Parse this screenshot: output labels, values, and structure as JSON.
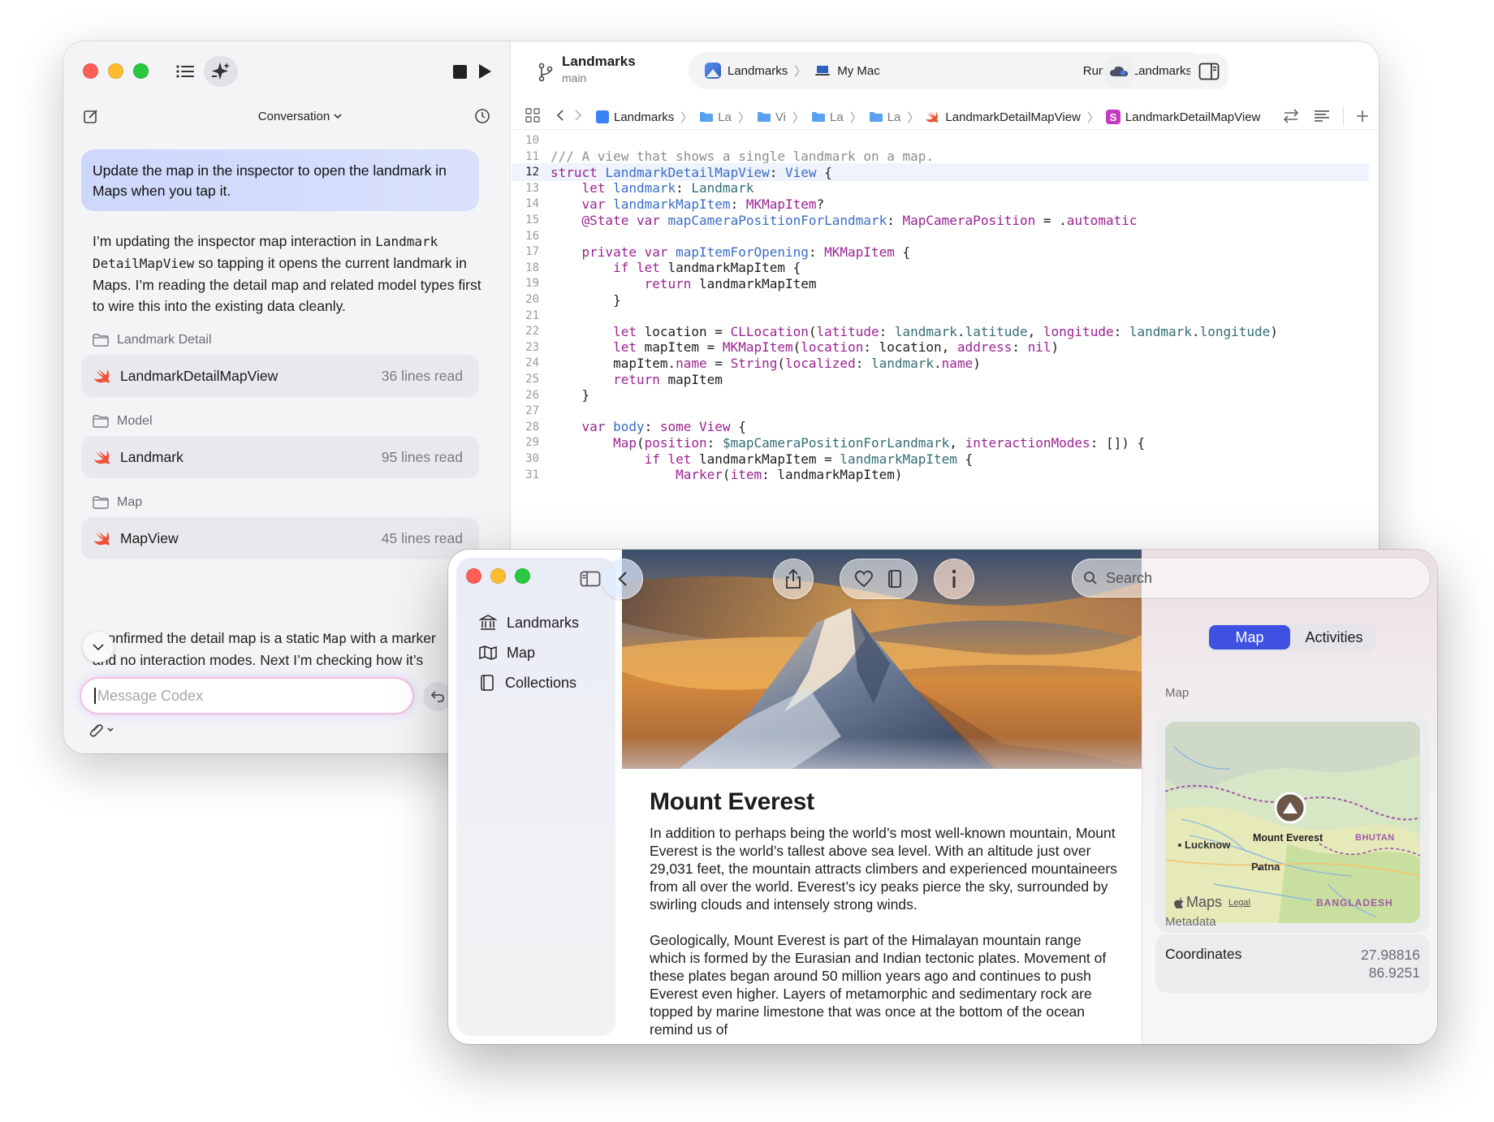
{
  "codex": {
    "conversation_title": "Conversation",
    "user_message": "Update the map in the inspector to open the landmark in Maps when you tap it.",
    "reply1": {
      "before": "I’m updating the inspector map interaction in ",
      "code1": "Landmark",
      "code2": "DetailMapView",
      "after": " so tapping it opens the current landmark in Maps. I’m reading the detail map and related model types first to wire this into the existing data cleanly."
    },
    "groups": [
      {
        "label": "Landmark Detail",
        "file": "LandmarkDetailMapView",
        "meta": "36 lines read"
      },
      {
        "label": "Model",
        "file": "Landmark",
        "meta": "95 lines read"
      },
      {
        "label": "Map",
        "file": "MapView",
        "meta": "45 lines read"
      }
    ],
    "reply2": {
      "line1_before": "I confirmed the detail map is a static ",
      "line1_code": "Map",
      "line1_after": " with a marker",
      "line2": "and no interaction modes. Next I’m checking how it’s"
    },
    "composer_placeholder": "Message Codex"
  },
  "xcode": {
    "project_name": "Landmarks",
    "branch": "main",
    "scheme": "Landmarks",
    "destination": "My Mac",
    "status": "Running Landmarks",
    "breadcrumbs": [
      "Landmarks",
      "La",
      "Vi",
      "La",
      "La",
      "LandmarkDetailMapView",
      "LandmarkDetailMapView"
    ],
    "current_line": 12,
    "code": [
      {
        "n": "10",
        "t": [
          {
            "c": "pl",
            "s": ""
          }
        ]
      },
      {
        "n": "11",
        "t": [
          {
            "c": "cm",
            "s": "/// A view that shows a single landmark on a map."
          }
        ]
      },
      {
        "n": "12",
        "t": [
          {
            "c": "kw",
            "s": "struct "
          },
          {
            "c": "ty",
            "s": "LandmarkDetailMapView"
          },
          {
            "c": "pl",
            "s": ": "
          },
          {
            "c": "ty",
            "s": "View"
          },
          {
            "c": "pl",
            "s": " {"
          }
        ]
      },
      {
        "n": "13",
        "t": [
          {
            "c": "pl",
            "s": "    "
          },
          {
            "c": "kw",
            "s": "let "
          },
          {
            "c": "ty",
            "s": "landmark"
          },
          {
            "c": "pl",
            "s": ": "
          },
          {
            "c": "id",
            "s": "Landmark"
          }
        ]
      },
      {
        "n": "14",
        "t": [
          {
            "c": "pl",
            "s": "    "
          },
          {
            "c": "kw",
            "s": "var "
          },
          {
            "c": "ty",
            "s": "landmarkMapItem"
          },
          {
            "c": "pl",
            "s": ": "
          },
          {
            "c": "kw",
            "s": "MKMapItem"
          },
          {
            "c": "pl",
            "s": "?"
          }
        ]
      },
      {
        "n": "15",
        "t": [
          {
            "c": "pl",
            "s": "    "
          },
          {
            "c": "kw",
            "s": "@State var "
          },
          {
            "c": "ty",
            "s": "mapCameraPositionForLandmark"
          },
          {
            "c": "pl",
            "s": ": "
          },
          {
            "c": "kw",
            "s": "MapCameraPosition"
          },
          {
            "c": "pl",
            "s": " = ."
          },
          {
            "c": "kw",
            "s": "automatic"
          }
        ]
      },
      {
        "n": "16",
        "t": [
          {
            "c": "pl",
            "s": ""
          }
        ]
      },
      {
        "n": "17",
        "t": [
          {
            "c": "pl",
            "s": "    "
          },
          {
            "c": "kw",
            "s": "private var "
          },
          {
            "c": "ty",
            "s": "mapItemForOpening"
          },
          {
            "c": "pl",
            "s": ": "
          },
          {
            "c": "kw",
            "s": "MKMapItem"
          },
          {
            "c": "pl",
            "s": " {"
          }
        ]
      },
      {
        "n": "18",
        "t": [
          {
            "c": "pl",
            "s": "        "
          },
          {
            "c": "kw",
            "s": "if let "
          },
          {
            "c": "pl",
            "s": "landmarkMapItem {"
          }
        ]
      },
      {
        "n": "19",
        "t": [
          {
            "c": "pl",
            "s": "            "
          },
          {
            "c": "kw",
            "s": "return "
          },
          {
            "c": "pl",
            "s": "landmarkMapItem"
          }
        ]
      },
      {
        "n": "20",
        "t": [
          {
            "c": "pl",
            "s": "        }"
          }
        ]
      },
      {
        "n": "21",
        "t": [
          {
            "c": "pl",
            "s": ""
          }
        ]
      },
      {
        "n": "22",
        "t": [
          {
            "c": "pl",
            "s": "        "
          },
          {
            "c": "kw",
            "s": "let "
          },
          {
            "c": "pl",
            "s": "location = "
          },
          {
            "c": "kw",
            "s": "CLLocation"
          },
          {
            "c": "pl",
            "s": "("
          },
          {
            "c": "kw",
            "s": "latitude"
          },
          {
            "c": "pl",
            "s": ": "
          },
          {
            "c": "id",
            "s": "landmark"
          },
          {
            "c": "pl",
            "s": "."
          },
          {
            "c": "id",
            "s": "latitude"
          },
          {
            "c": "pl",
            "s": ", "
          },
          {
            "c": "kw",
            "s": "longitude"
          },
          {
            "c": "pl",
            "s": ": "
          },
          {
            "c": "id",
            "s": "landmark"
          },
          {
            "c": "pl",
            "s": "."
          },
          {
            "c": "id",
            "s": "longitude"
          },
          {
            "c": "pl",
            "s": ")"
          }
        ]
      },
      {
        "n": "23",
        "t": [
          {
            "c": "pl",
            "s": "        "
          },
          {
            "c": "kw",
            "s": "let "
          },
          {
            "c": "pl",
            "s": "mapItem = "
          },
          {
            "c": "kw",
            "s": "MKMapItem"
          },
          {
            "c": "pl",
            "s": "("
          },
          {
            "c": "kw",
            "s": "location"
          },
          {
            "c": "pl",
            "s": ": location, "
          },
          {
            "c": "kw",
            "s": "address"
          },
          {
            "c": "pl",
            "s": ": "
          },
          {
            "c": "kw",
            "s": "nil"
          },
          {
            "c": "pl",
            "s": ")"
          }
        ]
      },
      {
        "n": "24",
        "t": [
          {
            "c": "pl",
            "s": "        mapItem."
          },
          {
            "c": "kw",
            "s": "name"
          },
          {
            "c": "pl",
            "s": " = "
          },
          {
            "c": "kw",
            "s": "String"
          },
          {
            "c": "pl",
            "s": "("
          },
          {
            "c": "kw",
            "s": "localized"
          },
          {
            "c": "pl",
            "s": ": "
          },
          {
            "c": "id",
            "s": "landmark"
          },
          {
            "c": "pl",
            "s": "."
          },
          {
            "c": "kw",
            "s": "name"
          },
          {
            "c": "pl",
            "s": ")"
          }
        ]
      },
      {
        "n": "25",
        "t": [
          {
            "c": "pl",
            "s": "        "
          },
          {
            "c": "kw",
            "s": "return "
          },
          {
            "c": "pl",
            "s": "mapItem"
          }
        ]
      },
      {
        "n": "26",
        "t": [
          {
            "c": "pl",
            "s": "    }"
          }
        ]
      },
      {
        "n": "27",
        "t": [
          {
            "c": "pl",
            "s": ""
          }
        ]
      },
      {
        "n": "28",
        "t": [
          {
            "c": "pl",
            "s": "    "
          },
          {
            "c": "kw",
            "s": "var "
          },
          {
            "c": "ty",
            "s": "body"
          },
          {
            "c": "pl",
            "s": ": "
          },
          {
            "c": "kw",
            "s": "some "
          },
          {
            "c": "kw",
            "s": "View"
          },
          {
            "c": "pl",
            "s": " {"
          }
        ]
      },
      {
        "n": "29",
        "t": [
          {
            "c": "pl",
            "s": "        "
          },
          {
            "c": "kw",
            "s": "Map"
          },
          {
            "c": "pl",
            "s": "("
          },
          {
            "c": "kw",
            "s": "position"
          },
          {
            "c": "pl",
            "s": ": "
          },
          {
            "c": "id",
            "s": "$mapCameraPositionForLandmark"
          },
          {
            "c": "pl",
            "s": ", "
          },
          {
            "c": "kw",
            "s": "interactionModes"
          },
          {
            "c": "pl",
            "s": ": []) {"
          }
        ]
      },
      {
        "n": "30",
        "t": [
          {
            "c": "pl",
            "s": "            "
          },
          {
            "c": "kw",
            "s": "if let "
          },
          {
            "c": "pl",
            "s": "landmarkMapItem = "
          },
          {
            "c": "id",
            "s": "landmarkMapItem"
          },
          {
            "c": "pl",
            "s": " {"
          }
        ]
      },
      {
        "n": "31",
        "t": [
          {
            "c": "pl",
            "s": "                "
          },
          {
            "c": "kw",
            "s": "Marker"
          },
          {
            "c": "pl",
            "s": "("
          },
          {
            "c": "kw",
            "s": "item"
          },
          {
            "c": "pl",
            "s": ": landmarkMapItem)"
          }
        ]
      }
    ]
  },
  "landmarks_app": {
    "sidebar": [
      {
        "label": "Landmarks",
        "icon": "building-columns-icon"
      },
      {
        "label": "Map",
        "icon": "map-icon"
      },
      {
        "label": "Collections",
        "icon": "book-icon"
      }
    ],
    "search_placeholder": "Search",
    "title": "Mount Everest",
    "paragraphs": [
      "In addition to perhaps being the world’s most well-known mountain, Mount Everest is the world’s tallest above sea level. With an altitude just over 29,031 feet, the mountain attracts climbers and experienced mountaineers from all over the world. Everest’s icy peaks pierce the sky, surrounded by swirling clouds and intensely strong winds.",
      "Geologically, Mount Everest is part of the Himalayan mountain range which is formed by the Eurasian and Indian tectonic plates. Movement of these plates began around 50 million years ago and continues to push Everest even higher. Layers of metamorphic and sedimentary rock are topped by marine limestone that was once at the bottom of the ocean remind us of"
    ],
    "inspector": {
      "tabs": [
        "Map",
        "Activities"
      ],
      "selected_tab": "Map",
      "map_section": "Map",
      "map_labels": {
        "lucknow": "Lucknow",
        "everest": "Mount Everest",
        "bhutan": "BHUTAN",
        "patna": "Patna",
        "bangladesh": "BANGLADESH",
        "brand": "Maps",
        "legal": "Legal"
      },
      "metadata_section": "Metadata",
      "coordinates_label": "Coordinates",
      "latitude": "27.98816",
      "longitude": "86.9251"
    }
  },
  "colors": {
    "accent": "#3f51e0",
    "swift": "#f05138",
    "keyword": "#9b2393",
    "type": "#3a6cc7"
  }
}
